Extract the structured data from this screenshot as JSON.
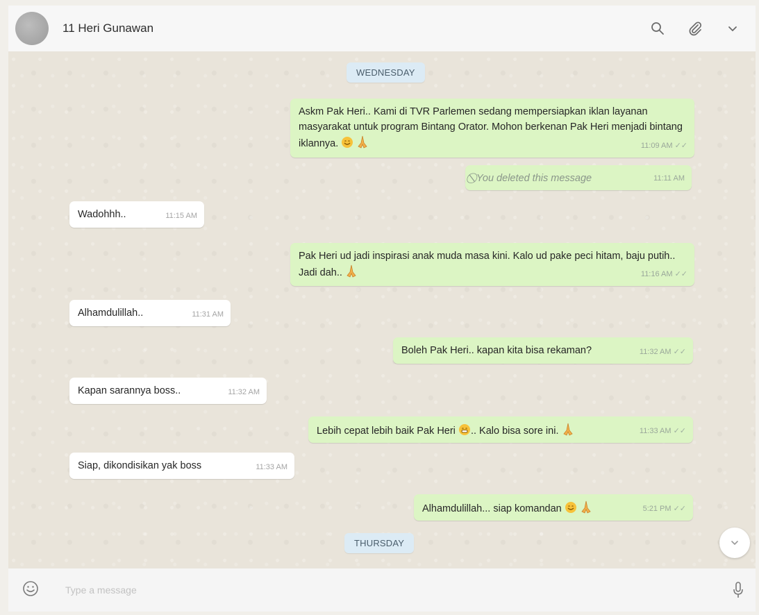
{
  "header": {
    "contact_name": "11 Heri Gunawan",
    "icons": [
      "search-icon",
      "paperclip-icon",
      "chevron-down-icon"
    ]
  },
  "chat": {
    "day_wednesday": "WEDNESDAY",
    "day_thursday": "THURSDAY",
    "messages": [
      {
        "dir": "out",
        "text": "Askm Pak Heri.. Kami di TVR Parlemen sedang mempersiapkan iklan layanan masyarakat untuk program Bintang Orator. Mohon berkenan Pak Heri menjadi bintang iklannya.",
        "time": "11:09 AM",
        "emojis": [
          "smile",
          "pray"
        ]
      },
      {
        "dir": "out",
        "text": "You deleted this message",
        "time": "11:11 AM",
        "deleted": true
      },
      {
        "dir": "in",
        "text": "Wadohhh..",
        "time": "11:15 AM"
      },
      {
        "dir": "out",
        "text": "Pak Heri ud jadi inspirasi anak muda masa kini. Kalo ud pake peci hitam, baju putih.. Jadi dah..",
        "time": "11:16 AM",
        "emojis": [
          "pray"
        ]
      },
      {
        "dir": "in",
        "text": "Alhamdulillah..",
        "time": "11:31 AM"
      },
      {
        "dir": "out",
        "text": "Boleh Pak Heri.. kapan kita bisa rekaman?",
        "time": "11:32 AM"
      },
      {
        "dir": "in",
        "text": "Kapan sarannya boss..",
        "time": "11:32 AM"
      },
      {
        "dir": "out",
        "text_a": "Lebih cepat lebih baik Pak Heri",
        "text_b": ".. Kalo bisa sore ini.",
        "time": "11:33 AM",
        "emojis": [
          "grin",
          "pray"
        ]
      },
      {
        "dir": "in",
        "text": "Siap, dikondisikan yak boss",
        "time": "11:33 AM"
      },
      {
        "dir": "out",
        "text": "Alhamdulillah... siap komandan",
        "time": "5:21 PM",
        "emojis": [
          "smile",
          "pray"
        ]
      }
    ]
  },
  "composer": {
    "placeholder": "Type a message",
    "icons": [
      "emoji-icon",
      "microphone-icon"
    ]
  },
  "colors": {
    "outgoing_bubble": "#dcf5c4",
    "incoming_bubble": "#ffffff",
    "day_chip": "#dcebf5"
  }
}
